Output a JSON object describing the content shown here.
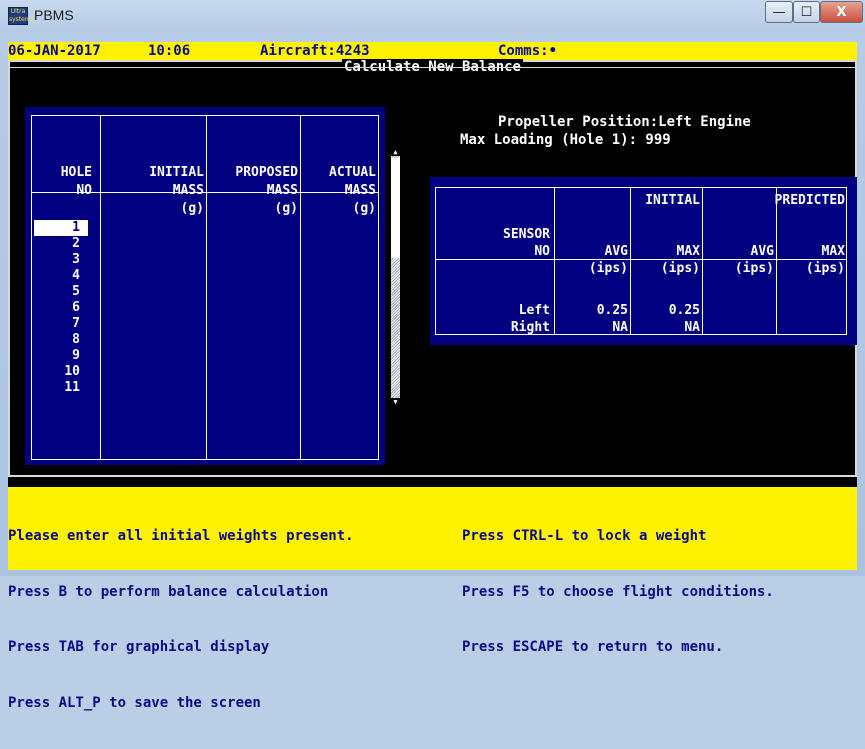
{
  "window": {
    "title": "PBMS",
    "app_icon": "Ultra\nsystems",
    "minimize": "—",
    "maximize": "☐",
    "close": "X"
  },
  "status": {
    "date": "06-JAN-2017",
    "time": "10:06",
    "aircraft": "Aircraft:4243",
    "comms": "Comms:•"
  },
  "screen_title": "Calculate New Balance",
  "info": {
    "propeller": "Propeller Position:Left Engine",
    "max_loading": "Max Loading (Hole 1): 999"
  },
  "hole_table": {
    "headers": [
      {
        "l1": "HOLE",
        "l2": "NO",
        "l3": ""
      },
      {
        "l1": "INITIAL",
        "l2": "MASS",
        "l3": "(g)"
      },
      {
        "l1": "PROPOSED",
        "l2": "MASS",
        "l3": "(g)"
      },
      {
        "l1": "ACTUAL",
        "l2": "MASS",
        "l3": "(g)"
      }
    ],
    "holes": [
      "1",
      "2",
      "3",
      "4",
      "5",
      "6",
      "7",
      "8",
      "9",
      "10",
      "11"
    ]
  },
  "sensor_table": {
    "sensor_h1": "SENSOR",
    "sensor_h2": "NO",
    "initial": "INITIAL",
    "predicted": "PREDICTED",
    "avg": "AVG",
    "max": "MAX",
    "unit": "(ips)",
    "rows": [
      {
        "name": "Left",
        "init_avg": "0.25",
        "init_max": "0.25"
      },
      {
        "name": "Right",
        "init_avg": "NA",
        "init_max": "NA"
      }
    ]
  },
  "footer": {
    "left": [
      "Please enter all initial weights present.",
      "Press B to perform balance calculation",
      "Press TAB for graphical display",
      "Press ALT_P to save the screen"
    ],
    "right": [
      "Press CTRL-L to lock a weight",
      "Press F5 to choose flight conditions.",
      "Press ESCAPE to return to menu."
    ]
  }
}
